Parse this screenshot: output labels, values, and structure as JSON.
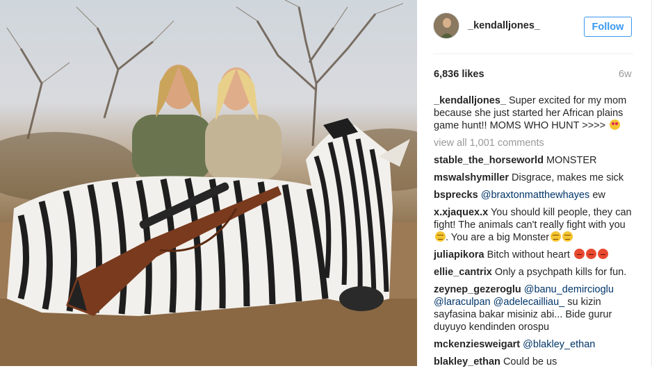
{
  "post": {
    "username": "_kendalljones_",
    "follow_label": "Follow",
    "likes": "6,836 likes",
    "age": "6w",
    "view_all": "view all 1,001 comments"
  },
  "comments": [
    {
      "user": "_kendalljones_",
      "text": "Super excited for my mom because she just started her African plains game hunt!! MOMS WHO HUNT >>>> ",
      "emoji": [
        "heart-eyes"
      ]
    },
    {
      "user": "stable_the_horseworld",
      "text": "MONSTER"
    },
    {
      "user": "mswalshymiller",
      "text": "Disgrace, makes me sick"
    },
    {
      "user": "bsprecks",
      "mention": "@braxtonmatthewhayes",
      "text": "ew"
    },
    {
      "user": "x.xjaquex.x",
      "text": "You should kill people, they can fight! The animals can't really fight with you",
      "text2": ". You are a big Monster"
    },
    {
      "user": "juliapikora",
      "text": "Bitch without heart",
      "emoji": [
        "angry",
        "angry",
        "angry"
      ]
    },
    {
      "user": "ellie_cantrix",
      "text": "Only a psychpath kills for fun."
    },
    {
      "user": "zeynep_gezeroglu",
      "mention": "@banu_demircioglu @laraculpan @adelecailliau_",
      "text": "su kizin sayfasina bakar misiniz abi... Bide gurur duyuyo kendinden orospu"
    },
    {
      "user": "mckenziesweigart",
      "mention": "@blakley_ethan",
      "text": ""
    },
    {
      "user": "blakley_ethan",
      "text": "Could be us"
    }
  ],
  "colors": {
    "accent": "#3897f0",
    "mention": "#003569",
    "muted": "#999999",
    "text": "#262626"
  },
  "icons": {
    "heart_eyes": "smiling-face-with-heart-eyes",
    "unamused": "unamused-face",
    "angry": "angry-face"
  }
}
